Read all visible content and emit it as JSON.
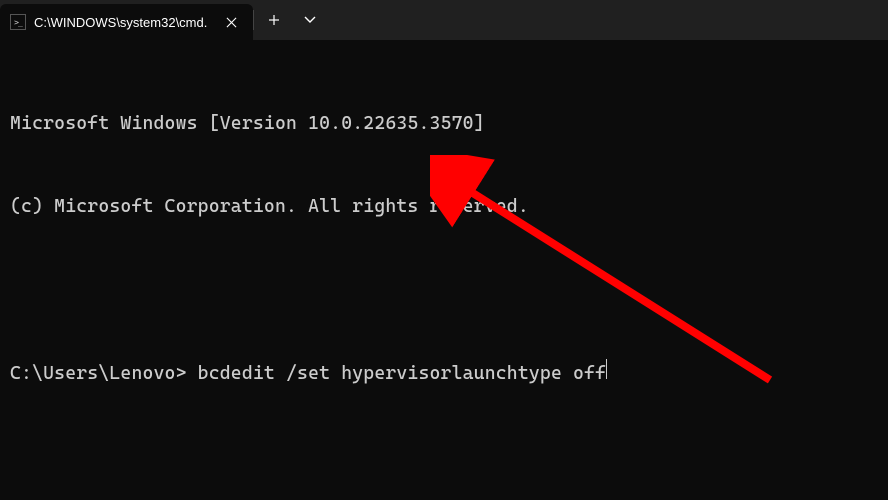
{
  "tab": {
    "title": "C:\\WINDOWS\\system32\\cmd."
  },
  "terminal": {
    "banner_line1": "Microsoft Windows [Version 10.0.22635.3570]",
    "banner_line2": "(c) Microsoft Corporation. All rights reserved.",
    "prompt": "C:\\Users\\Lenovo>",
    "command": "bcdedit /set hypervisorlaunchtype off"
  },
  "colors": {
    "arrow": "#ff0000"
  }
}
